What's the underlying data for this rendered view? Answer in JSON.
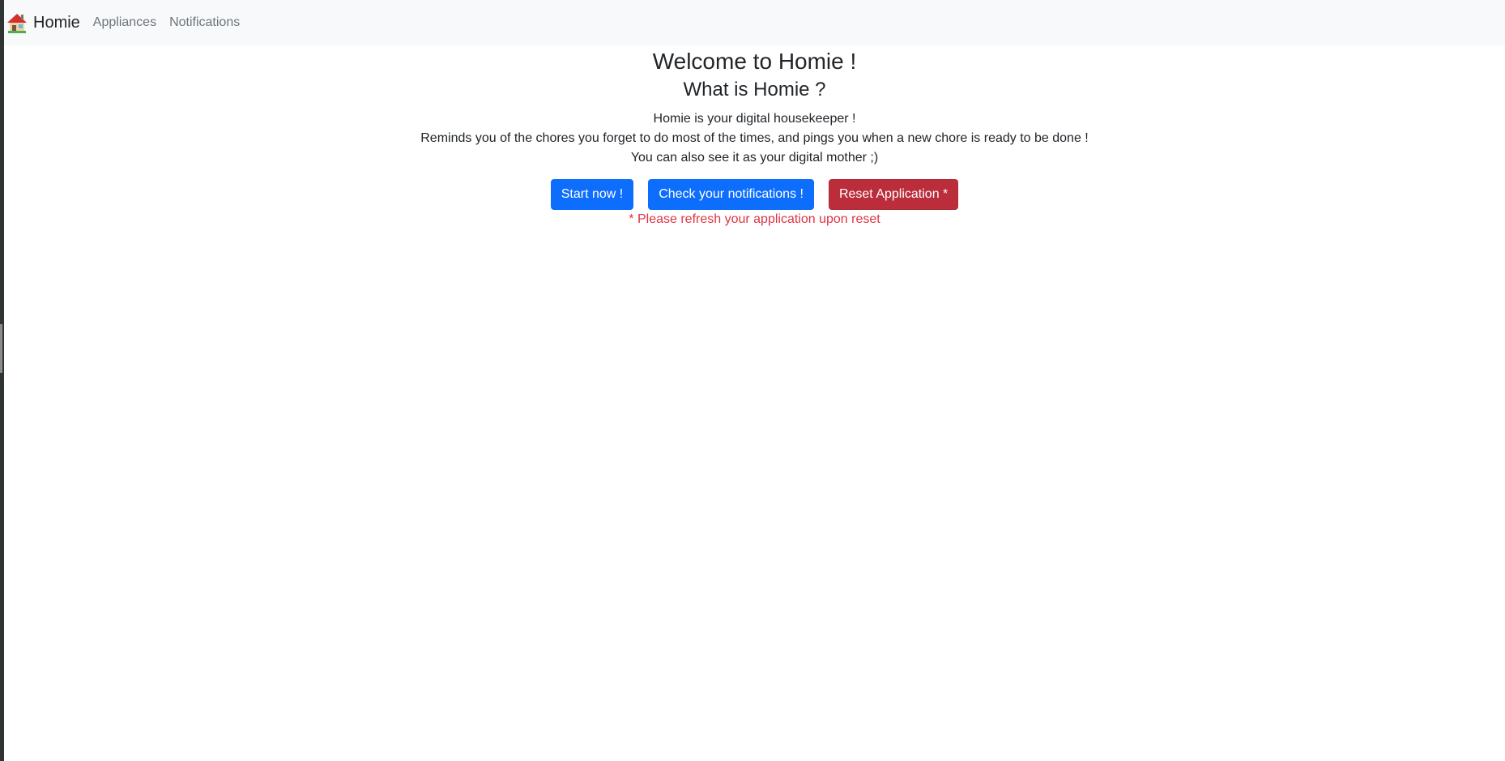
{
  "navbar": {
    "brand": "Homie",
    "brand_icon": "house-icon",
    "links": [
      "Appliances",
      "Notifications"
    ]
  },
  "main": {
    "title": "Welcome to Homie !",
    "subtitle": "What is Homie ?",
    "description": [
      "Homie is your digital housekeeper !",
      "Reminds you of the chores you forget to do most of the times, and pings you when a new chore is ready to be done !",
      "You can also see it as your digital mother ;)"
    ],
    "buttons": {
      "start": "Start now !",
      "notifications": "Check your notifications !",
      "reset": "Reset Application *"
    },
    "note": "* Please refresh your application upon reset"
  },
  "colors": {
    "primary": "#0d6efd",
    "danger": "#bb2d3b",
    "note": "#dc3545",
    "navbar_bg": "#f8f9fa"
  }
}
